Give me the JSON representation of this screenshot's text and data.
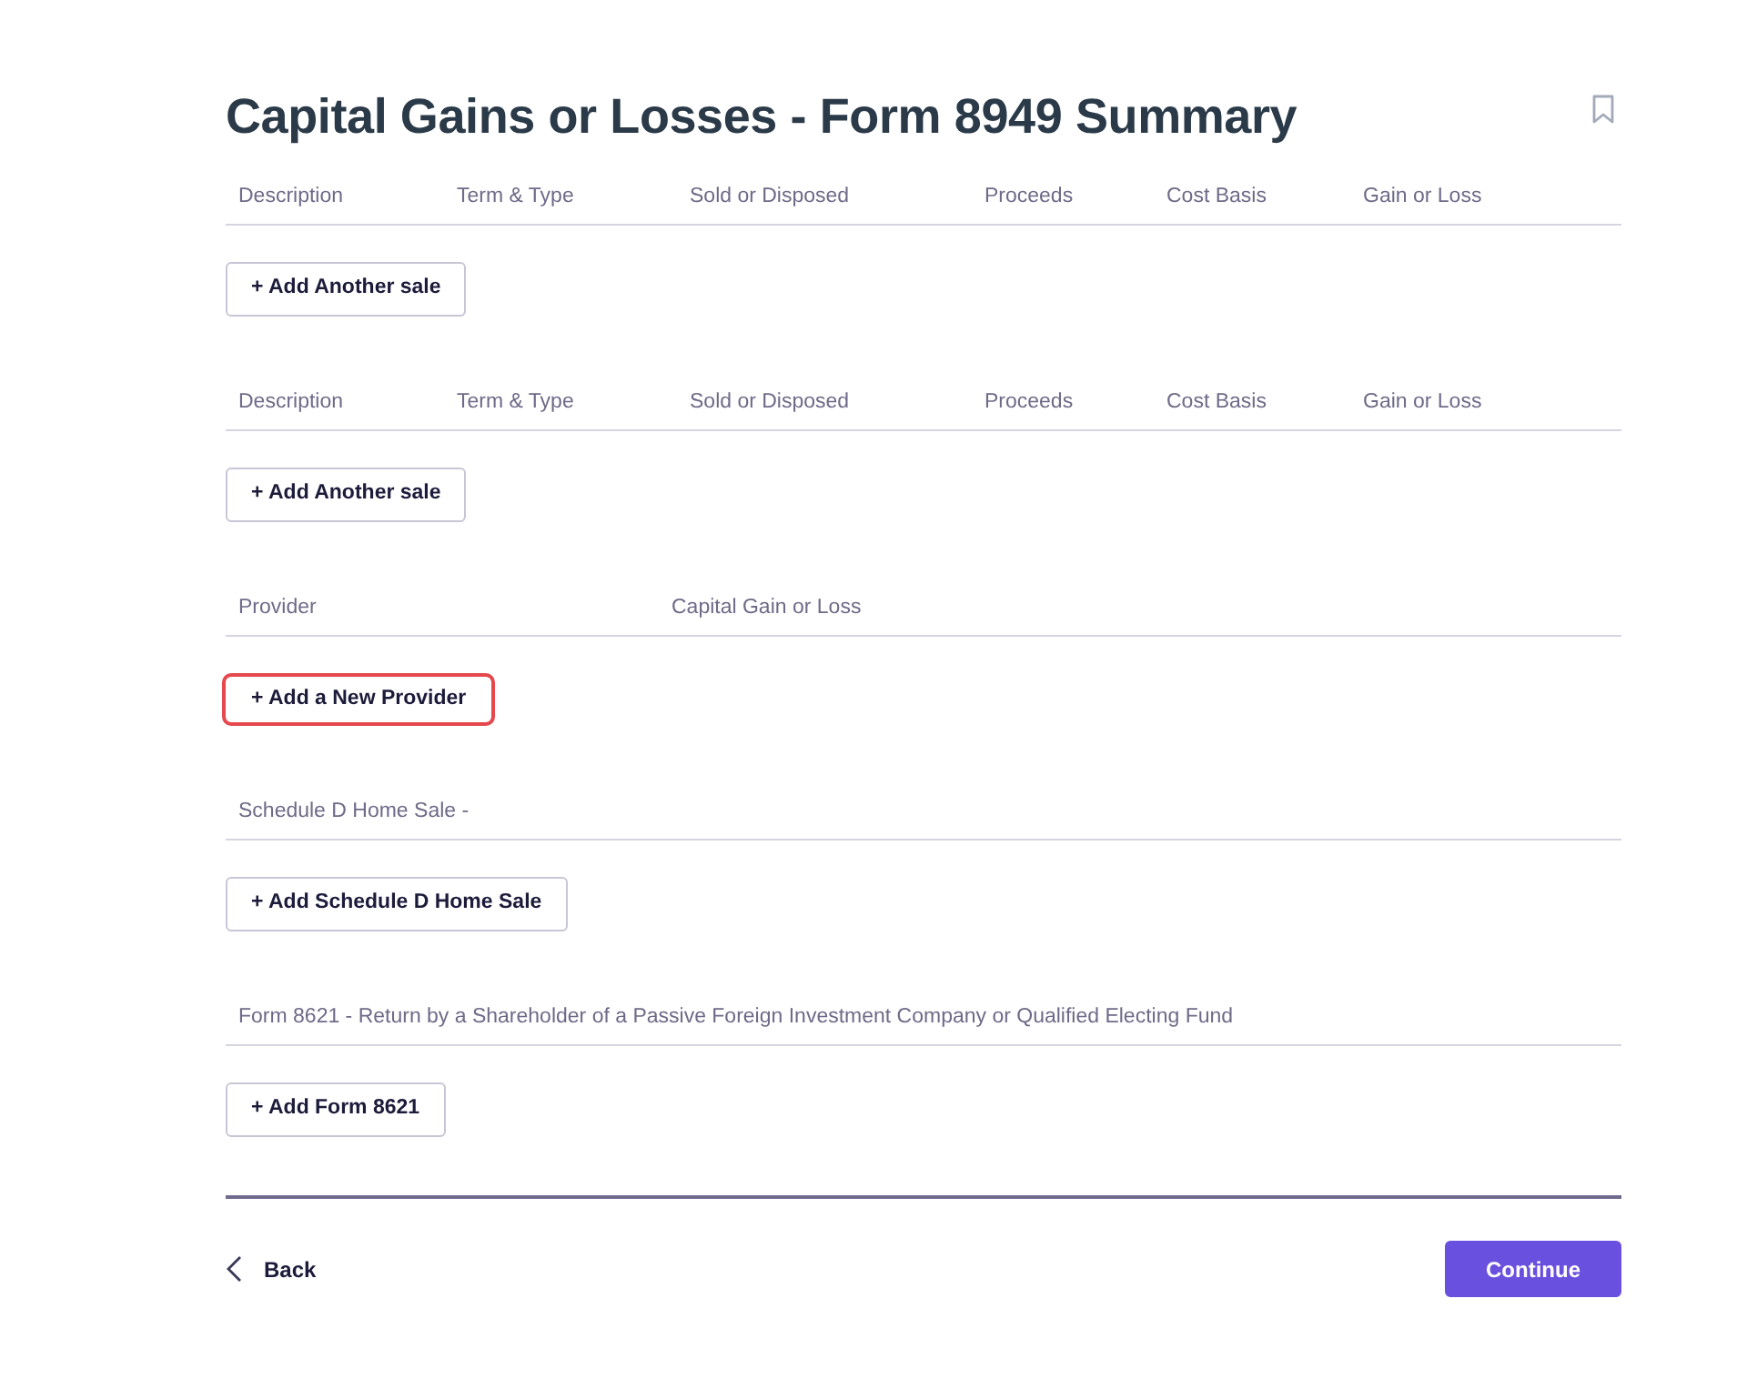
{
  "page": {
    "title": "Capital Gains or Losses - Form 8949 Summary"
  },
  "sections": [
    {
      "kind": "sales",
      "columns": [
        "Description",
        "Term & Type",
        "Sold or Disposed",
        "Proceeds",
        "Cost Basis",
        "Gain or Loss"
      ],
      "button": {
        "label": "+ Add Another sale",
        "highlighted": false
      }
    },
    {
      "kind": "sales",
      "columns": [
        "Description",
        "Term & Type",
        "Sold or Disposed",
        "Proceeds",
        "Cost Basis",
        "Gain or Loss"
      ],
      "button": {
        "label": "+ Add Another sale",
        "highlighted": false
      }
    },
    {
      "kind": "providers",
      "columns": [
        "Provider",
        "Capital Gain or Loss"
      ],
      "button": {
        "label": "+ Add a New Provider",
        "highlighted": true
      }
    },
    {
      "kind": "single",
      "columns": [
        "Schedule D Home Sale -"
      ],
      "button": {
        "label": "+ Add Schedule D Home Sale",
        "highlighted": false
      }
    },
    {
      "kind": "single",
      "columns": [
        "Form 8621 - Return by a Shareholder of a Passive Foreign Investment Company or Qualified Electing Fund"
      ],
      "button": {
        "label": "+ Add Form 8621",
        "highlighted": false
      }
    }
  ],
  "footer": {
    "back": "Back",
    "continue": "Continue"
  }
}
